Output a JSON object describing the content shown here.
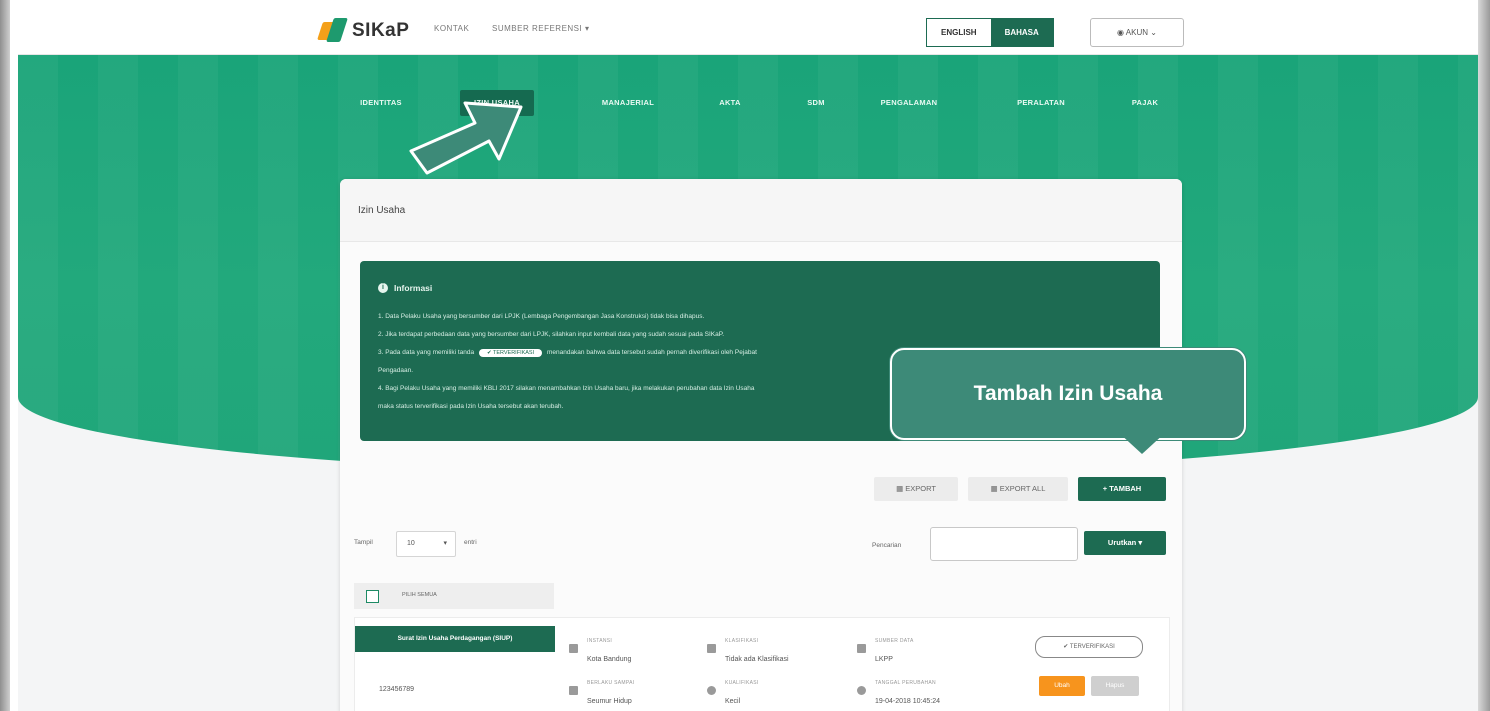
{
  "brand": {
    "name": "SIKaP"
  },
  "topnav": {
    "kontak": "KONTAK",
    "sumber": "SUMBER REFERENSI ▾"
  },
  "lang": {
    "english": "ENGLISH",
    "bahasa": "BAHASA"
  },
  "akun": "AKUN",
  "tabs": [
    "IDENTITAS",
    "IZIN USAHA",
    "MANAJERIAL",
    "AKTA",
    "SDM",
    "PENGALAMAN",
    "PERALATAN",
    "PAJAK"
  ],
  "card": {
    "title": "Izin Usaha"
  },
  "info": {
    "title": "Informasi",
    "line1": "1. Data Pelaku Usaha yang bersumber dari LPJK (Lembaga Pengembangan Jasa Konstruksi) tidak bisa dihapus.",
    "line2": "2. Jika terdapat perbedaan data yang bersumber dari LPJK, silahkan input kembali data yang sudah sesuai pada SIKaP.",
    "line3a": "3. Pada data yang memiliki tanda",
    "line3pill": "✔ TERVERIFIKASI",
    "line3b": "menandakan bahwa data tersebut sudah pernah diverifikasi oleh Pejabat",
    "line3c": "Pengadaan.",
    "line4": "4. Bagi Pelaku Usaha yang memiliki KBLI 2017 silakan menambahkan Izin Usaha baru, jika melakukan perubahan data Izin Usaha",
    "line5": "maka status terverifikasi pada Izin Usaha tersebut akan terubah."
  },
  "toolbar": {
    "export": "EXPORT",
    "export_all": "EXPORT ALL",
    "tambah": "+ TAMBAH"
  },
  "list": {
    "tampil": "Tampil",
    "entries": "10",
    "entri": "entri",
    "pencarian": "Pencarian",
    "urutkan": "Urutkan ▾",
    "pilih_semua": "PILIH SEMUA"
  },
  "row": {
    "jenis": "Surat Izin Usaha Perdagangan (SIUP)",
    "nomor": "123456789",
    "instansi_label": "INSTANSI",
    "instansi": "Kota Bandung",
    "klasifikasi_label": "KLASIFIKASI",
    "klasifikasi": "Tidak ada Klasifikasi",
    "sumber_label": "SUMBER DATA",
    "sumber": "LKPP",
    "berlaku_label": "BERLAKU SAMPAI",
    "berlaku": "Seumur Hidup",
    "kualifikasi_label": "KUALIFIKASI",
    "kualifikasi": "Kecil",
    "tanggal_label": "TANGGAL PERUBAHAN",
    "tanggal": "19-04-2018 10:45:24",
    "verif": "✔ TERVERIFIKASI",
    "ubah": "Ubah",
    "hapus": "Hapus"
  },
  "callout": {
    "text": "Tambah Izin Usaha"
  },
  "colors": {
    "primary": "#1d6b52",
    "hero": "#1aa479",
    "callout": "#3d8a78",
    "edit": "#f7941d"
  }
}
